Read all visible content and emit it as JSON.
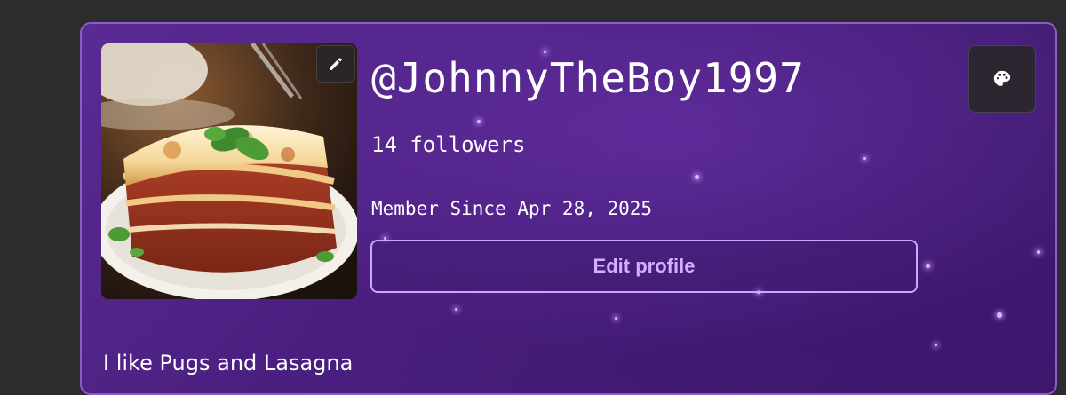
{
  "profile": {
    "username": "@JohnnyTheBoy1997",
    "followers_text": "14 followers",
    "member_since": "Member Since Apr 28, 2025",
    "edit_profile_label": "Edit profile",
    "bio": "I like Pugs and Lasagna",
    "avatar_description_icon": "lasagna-photo",
    "edit_avatar_icon": "pencil-icon",
    "theme_icon": "palette-icon"
  },
  "colors": {
    "page_background": "#2c2c2e",
    "card_border": "#8a5cc7",
    "card_background": "#4b1f80",
    "button_border": "#c9a6ff",
    "button_text": "#d0b0ff"
  }
}
